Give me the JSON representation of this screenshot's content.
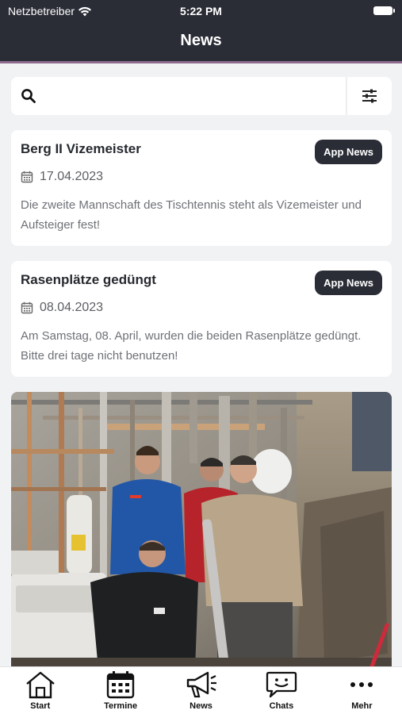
{
  "status": {
    "carrier": "Netzbetreiber",
    "time": "5:22 PM"
  },
  "header": {
    "title": "News"
  },
  "search": {
    "placeholder": ""
  },
  "news": [
    {
      "title": "Berg II Vizemeister",
      "badge": "App News",
      "date": "17.04.2023",
      "text": "Die zweite Mannschaft des Tischtennis steht als Vizemeister und Aufsteiger fest!"
    },
    {
      "title": "Rasenplätze gedüngt",
      "badge": "App News",
      "date": "08.04.2023",
      "text": "Am Samstag, 08. April, wurden die beiden Rasenplätze gedüngt. Bitte drei tage nicht benutzen!"
    }
  ],
  "tabs": [
    {
      "label": "Start",
      "icon": "home-icon"
    },
    {
      "label": "Termine",
      "icon": "calendar-icon"
    },
    {
      "label": "News",
      "icon": "megaphone-icon"
    },
    {
      "label": "Chats",
      "icon": "chat-icon"
    },
    {
      "label": "Mehr",
      "icon": "more-icon"
    }
  ],
  "colors": {
    "header": "#2a2d36",
    "accent": "#8e6a8f",
    "background": "#f1f2f4"
  }
}
